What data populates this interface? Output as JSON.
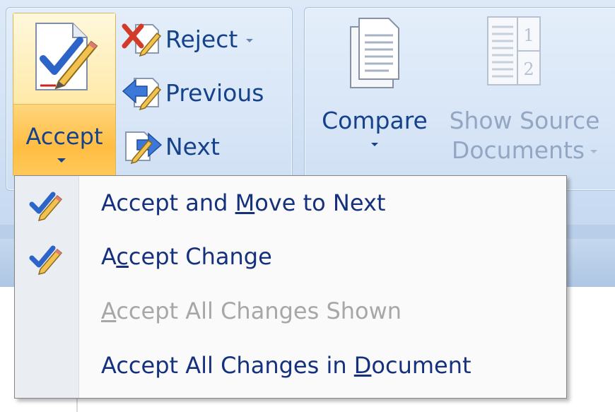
{
  "ribbon": {
    "accept": {
      "label": "Accept"
    },
    "reject": {
      "label": "Reject"
    },
    "previous": {
      "label": "Previous"
    },
    "next": {
      "label": "Next"
    },
    "compare": {
      "label": "Compare"
    },
    "show_source": {
      "label_line1": "Show Source",
      "label_line2": "Documents",
      "enabled": false
    }
  },
  "menu": {
    "items": [
      {
        "pre": "Accept and ",
        "mnemonic": "M",
        "post": "ove to Next",
        "enabled": true,
        "icon": "accept-change-icon"
      },
      {
        "pre": "A",
        "mnemonic": "c",
        "post": "cept Change",
        "enabled": true,
        "icon": "accept-change-icon"
      },
      {
        "pre": "",
        "mnemonic": "A",
        "post": "ccept All Changes Shown",
        "enabled": false,
        "icon": ""
      },
      {
        "pre": "Accept All Changes in ",
        "mnemonic": "D",
        "post": "ocument",
        "enabled": true,
        "icon": ""
      }
    ]
  },
  "colors": {
    "ribbon_text": "#15428b",
    "menu_text": "#15317e",
    "disabled_text": "#a7a7a7",
    "hover_orange": "#ffbd42"
  }
}
